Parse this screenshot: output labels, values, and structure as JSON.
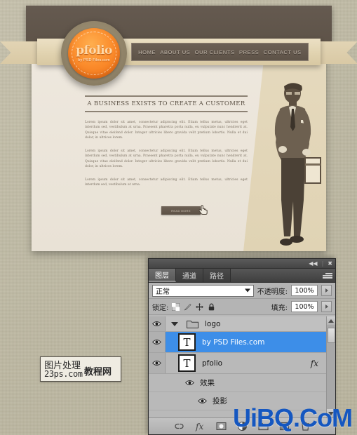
{
  "site": {
    "logo": {
      "word": "pfolio",
      "sub": "by PSD Files.com"
    },
    "nav": [
      {
        "label": "HOME"
      },
      {
        "label": "ABOUT US"
      },
      {
        "label": "OUR CLIENTS"
      },
      {
        "label": "PRESS"
      },
      {
        "label": "CONTACT US"
      }
    ],
    "article": {
      "headline": "A BUSINESS EXISTS TO CREATE A CUSTOMER",
      "paragraphs": [
        "Lorem ipsum dolor sit amet, consectetur adipiscing elit. Etiam tellus metus, ultricies eget interdum sed, vestibulum at urna. Praesent pharetra porta nulla, eu vulputate nunc hendrerit at. Quisque vitae eleifend dolor. Integer ultricies libero gravida velit pretium lobortis. Nulla et dui dolor, in ultrices lorem.",
        "Lorem ipsum dolor sit amet, consectetur adipiscing elit. Etiam tellus metus, ultricies eget interdum sed, vestibulum at urna. Praesent pharetra porta nulla, eu vulputate nunc hendrerit at. Quisque vitae eleifend dolor. Integer ultricies libero gravida velit pretium lobortis. Nulla et dui dolor, in ultrices lorem.",
        "Lorem ipsum dolor sit amet, consectetur adipiscing elit. Etiam tellus metus, ultricies eget interdum sed, vestibulum at urna."
      ],
      "read_more_label": "READ MORE"
    }
  },
  "watermark_box": {
    "line1": "图片处理",
    "line2": "23ps.com",
    "line3": "教程网"
  },
  "watermark_text": "UiBQ.CoM",
  "ps_panel": {
    "titlebar": {
      "collapse": "◀◀",
      "separator": "|",
      "close": "✖"
    },
    "tabs": [
      {
        "label": "图层",
        "active": true
      },
      {
        "label": "通道",
        "active": false
      },
      {
        "label": "路径",
        "active": false
      }
    ],
    "blend_mode": "正常",
    "opacity_label": "不透明度:",
    "opacity_value": "100%",
    "lock_label": "锁定:",
    "fill_label": "填充:",
    "fill_value": "100%",
    "layers": [
      {
        "type": "group",
        "name": "logo",
        "visible": true,
        "selected": false,
        "expanded": true,
        "fx": false
      },
      {
        "type": "text",
        "name": "by PSD Files.com",
        "visible": true,
        "selected": true,
        "thumb": "T",
        "fx": false
      },
      {
        "type": "text",
        "name": "pfolio",
        "visible": true,
        "selected": false,
        "thumb": "T",
        "fx": true,
        "fx_label": "fx"
      }
    ],
    "effects": [
      {
        "name": "效果",
        "visible": true,
        "sub": false
      },
      {
        "name": "投影",
        "visible": true,
        "sub": true
      }
    ]
  },
  "colors": {
    "desktop": "#c1bca7",
    "header_brown": "#5d5247",
    "ribbon_cream": "#e1d3b0",
    "page_cream": "#e9e2d6",
    "logo_orange": "#fb8c2c",
    "selection_blue": "#3d8ee8",
    "watermark_blue": "#1557c0"
  }
}
